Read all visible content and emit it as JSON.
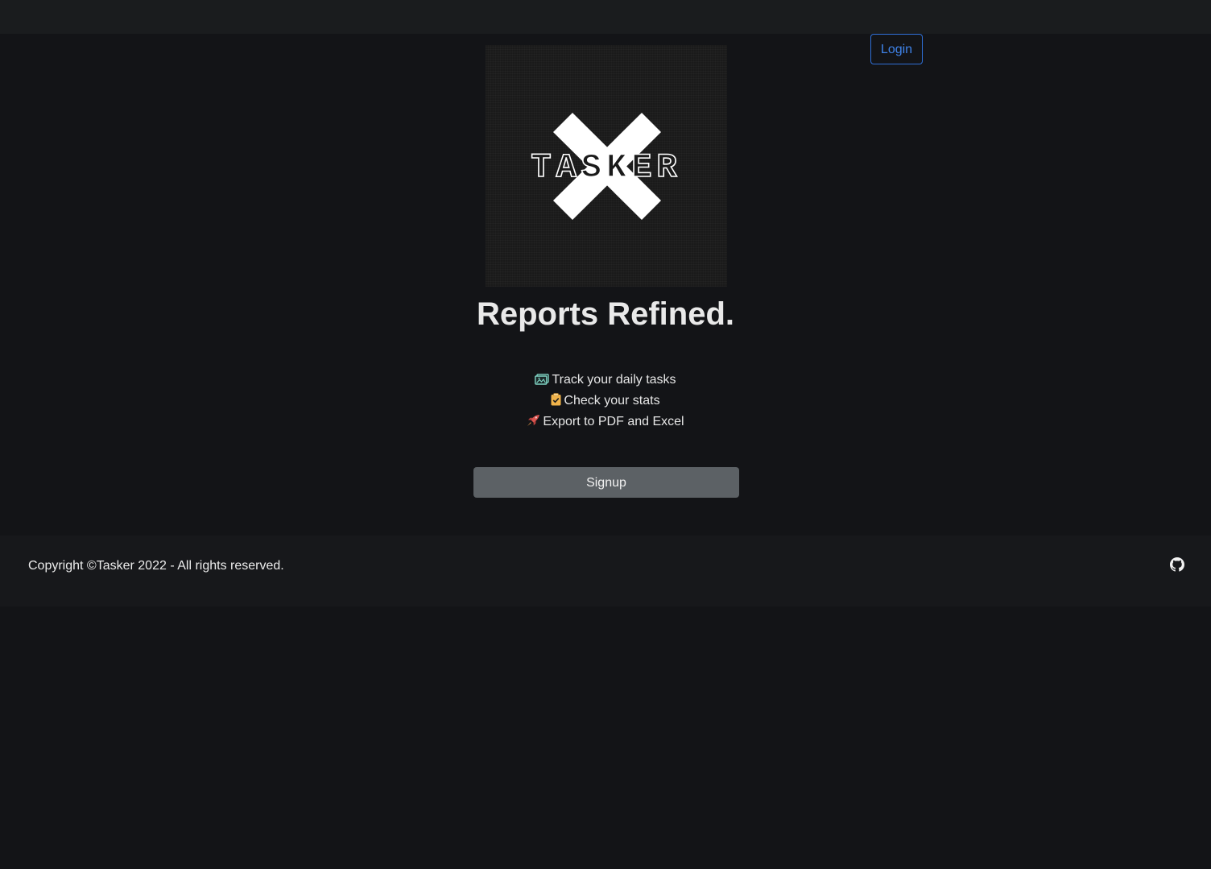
{
  "header": {
    "login_label": "Login"
  },
  "hero": {
    "logo_text": "TASKER",
    "headline": "Reports Refined.",
    "features": [
      {
        "icon": "image-icon",
        "label": "Track your daily tasks"
      },
      {
        "icon": "clipboard-check-icon",
        "label": "Check your stats"
      },
      {
        "icon": "rocket-icon",
        "label": "Export to PDF and Excel"
      }
    ],
    "signup_label": "Signup"
  },
  "footer": {
    "copyright": "Copyright ©Tasker 2022 - All rights reserved.",
    "github_icon": "github-icon"
  },
  "colors": {
    "background": "#131417",
    "topbar": "#1a1c1e",
    "footer": "#17181b",
    "login_accent": "#3f83ea",
    "signup_button": "#5c6165",
    "image_icon": "#7fd3c3",
    "clipboard_icon": "#f0b34a",
    "rocket_icon": "#d9534f"
  }
}
